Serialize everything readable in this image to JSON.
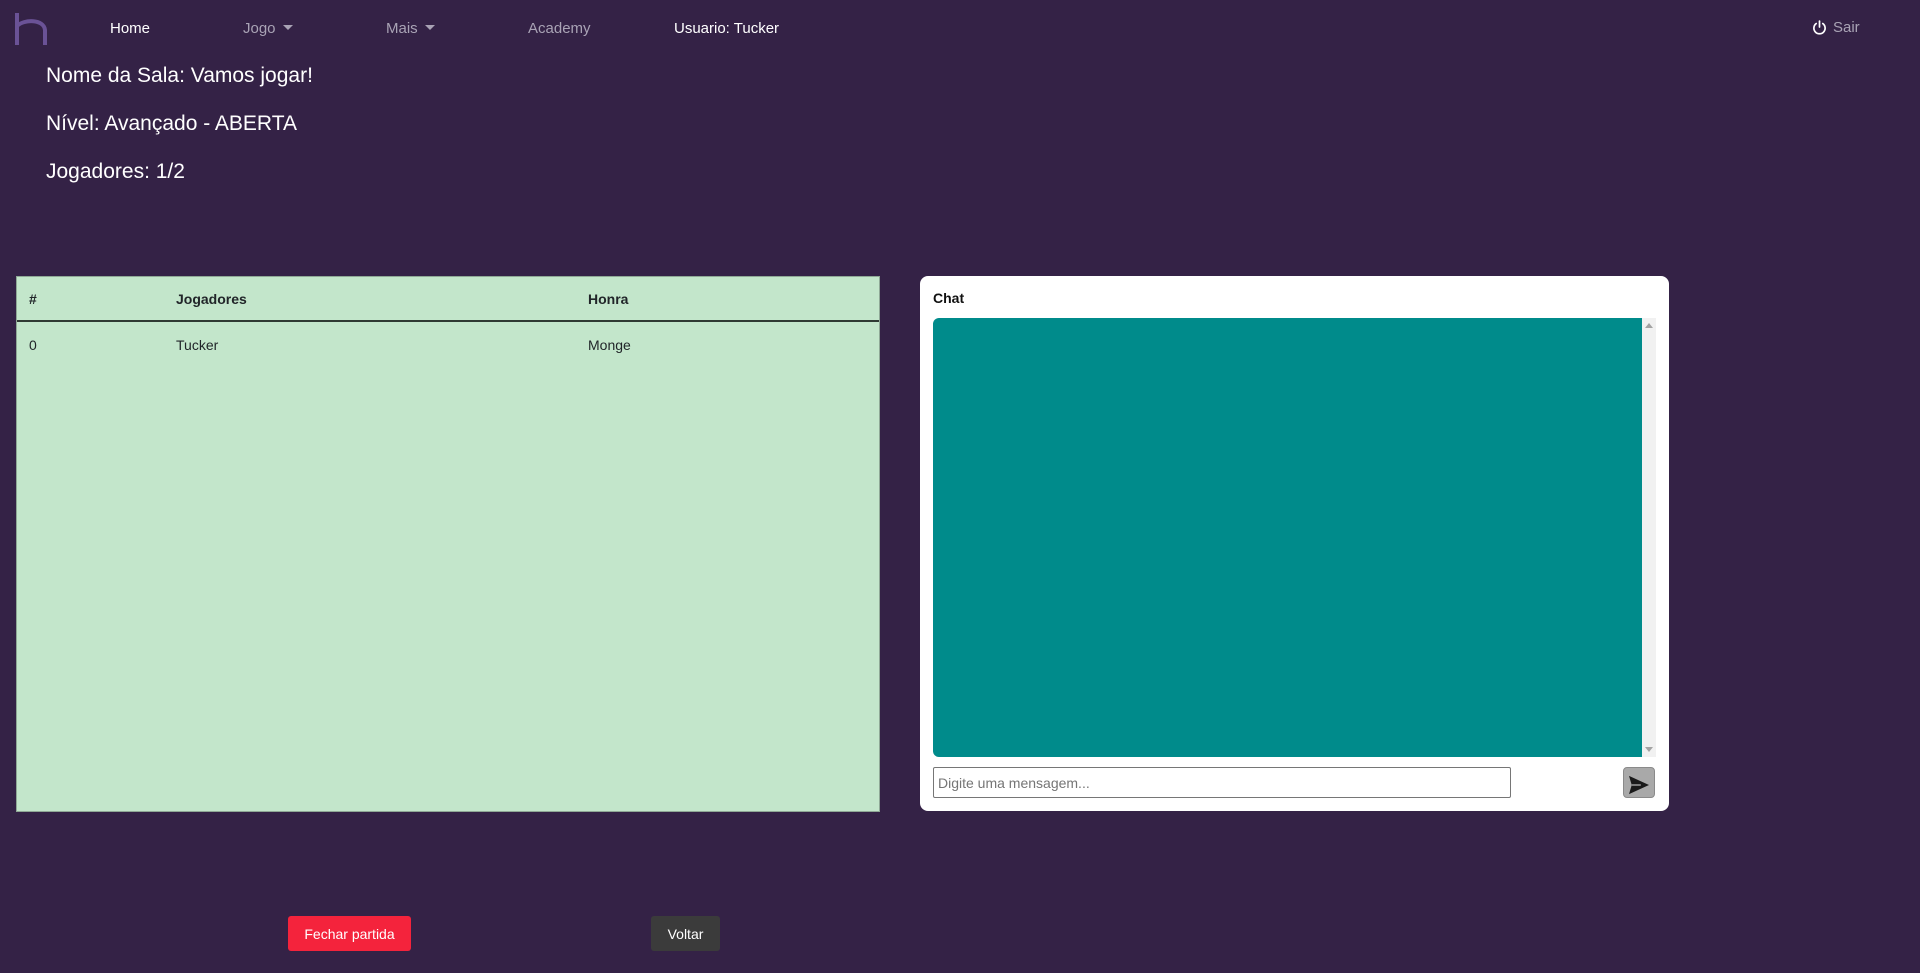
{
  "nav": {
    "logo_icon": "h-logo-icon",
    "home": "Home",
    "jogo": "Jogo",
    "mais": "Mais",
    "academy": "Academy",
    "usuario": "Usuario: Tucker",
    "sair": "Sair",
    "sair_icon": "power-icon"
  },
  "room": {
    "nome": "Nome da Sala: Vamos jogar!",
    "nivel": "Nível: Avançado - ABERTA",
    "jogadores": "Jogadores: 1/2"
  },
  "players_table": {
    "headers": [
      "#",
      "Jogadores",
      "Honra"
    ],
    "rows": [
      {
        "num": "0",
        "name": "Tucker",
        "honra": "Monge"
      }
    ]
  },
  "chat": {
    "title": "Chat",
    "placeholder": "Digite uma mensagem...",
    "send_icon": "send-icon"
  },
  "actions": {
    "fechar": "Fechar partida",
    "voltar": "Voltar"
  },
  "colors": {
    "background": "#342246",
    "table_bg": "#c3e6cb",
    "chat_area": "#008b8b",
    "danger": "#f4233c",
    "secondary": "#3b3b3b"
  }
}
